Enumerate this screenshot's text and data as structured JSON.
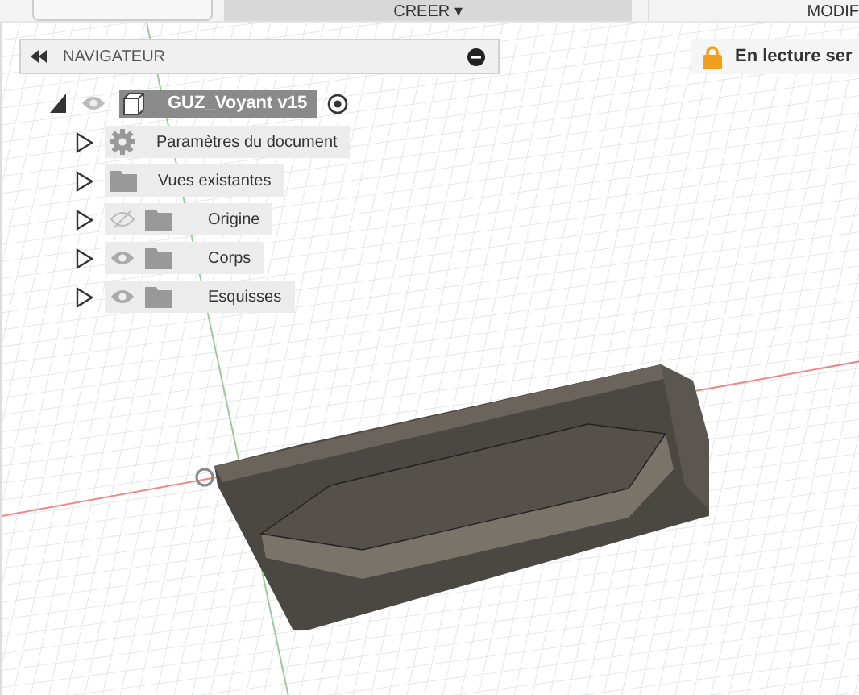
{
  "toolbar": {
    "tabs": [
      {
        "label": "CREER ▾",
        "selected": true
      },
      {
        "label": "MODIF",
        "selected": false
      }
    ]
  },
  "navigator": {
    "title": "NAVIGATEUR",
    "root": {
      "name": "GUZ_Voyant v15",
      "expanded": true,
      "visible": true,
      "active": true,
      "children": [
        {
          "label": "Paramètres du document",
          "kind": "settings",
          "expanded": false
        },
        {
          "label": "Vues existantes",
          "kind": "folder",
          "expanded": false
        },
        {
          "label": "Origine",
          "kind": "folder",
          "visible": false,
          "expanded": false
        },
        {
          "label": "Corps",
          "kind": "folder",
          "visible": true,
          "expanded": false
        },
        {
          "label": "Esquisses",
          "kind": "folder",
          "visible": true,
          "expanded": false
        }
      ]
    }
  },
  "banner": {
    "text": "En lecture ser"
  }
}
